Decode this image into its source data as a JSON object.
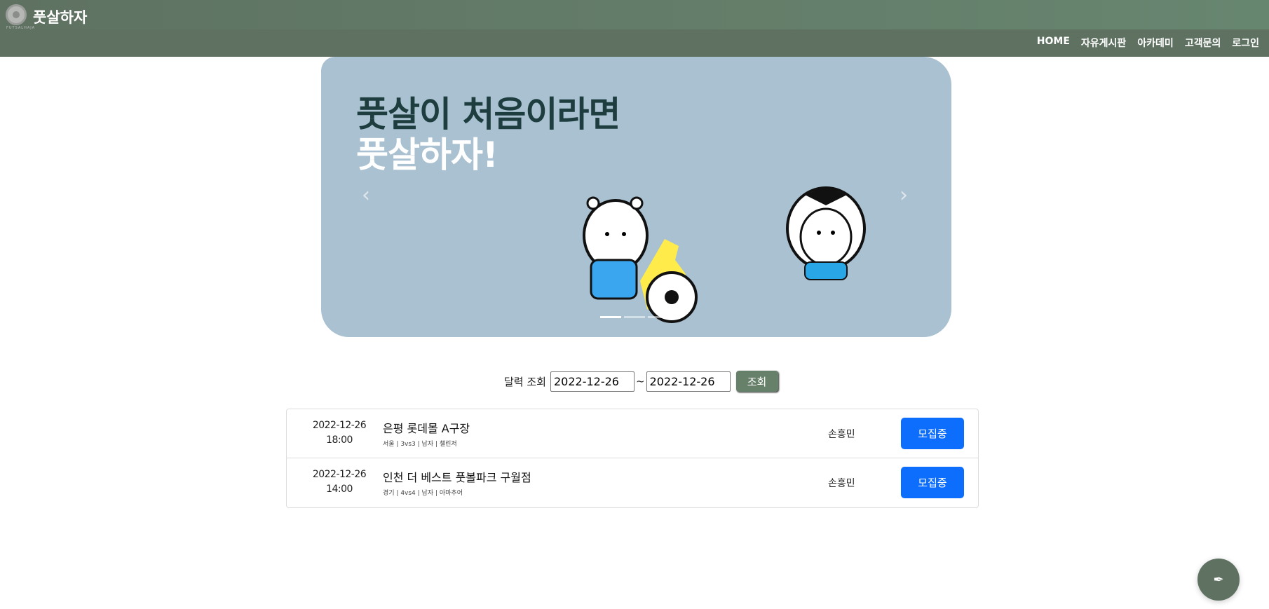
{
  "header": {
    "brand": "풋살하자",
    "logo_text": "FUTSALHAJA",
    "nav": [
      "HOME",
      "자유게시판",
      "아카데미",
      "고객문의",
      "로그인"
    ]
  },
  "banner": {
    "line1": "풋살이 처음이라면",
    "line2": "풋살하자!",
    "prev": "‹",
    "next": "›",
    "slides": 3,
    "active_slide": 1
  },
  "search": {
    "label": "달력 조회",
    "from": "2022-12-26",
    "separator": "~",
    "to": "2022-12-26",
    "button": "조회"
  },
  "matches": [
    {
      "date": "2022-12-26",
      "time": "18:00",
      "title": "은평 롯데몰 A구장",
      "meta": "서울 | 3vs3 | 남자 | 챌린저",
      "host": "손흥민",
      "status": "모집중"
    },
    {
      "date": "2022-12-26",
      "time": "14:00",
      "title": "인천 더 베스트 풋볼파크 구월점",
      "meta": "경기 | 4vs4 | 남자 | 아마추어",
      "host": "손흥민",
      "status": "모집중"
    }
  ],
  "fab": {
    "icon": "pen-icon",
    "glyph": "✒"
  },
  "colors": {
    "header": "#5f7262",
    "banner": "#a9c1d1",
    "primary": "#0d6efd",
    "search_button": "#668069"
  }
}
